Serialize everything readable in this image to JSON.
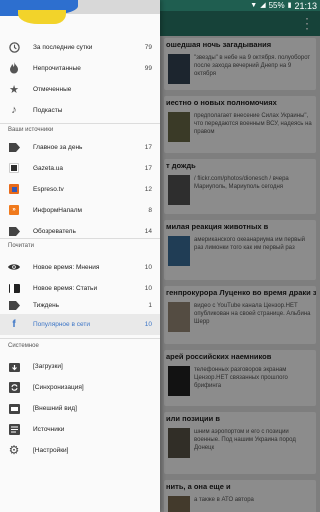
{
  "status": {
    "time": "21:13",
    "battery": "55%"
  },
  "colors": {
    "accent": "#3a74c6",
    "appbar": "#287868",
    "flag_blue": "#2d6fcf",
    "flag_yellow": "#f2d32a"
  },
  "feed": {
    "cards": [
      {
        "title": "ошедшая ночь загадывания",
        "text": "\"звезды\" в небе на 9 октября. полуоборот после захода вечерний Днепр на 9 октября"
      },
      {
        "title": "иестно о новых полномочиях",
        "text": "предполагает внесение Силах Украины\", что передаются военным ВСУ, надеясь на правом"
      },
      {
        "title": "т дождь",
        "text": "/ flickr.com/photos/dionesch / вчера Мариуполь, Мариуполь сегодня"
      },
      {
        "title": "милая реакция животных в",
        "text": "американского океанариума им первый раз лимонки того как им первый раз"
      },
      {
        "title": "генпрокурора Луценко во время драки за",
        "text": "видео с YouTube канала Цензор.НЕТ опубликован на своей странице. Альбина Шерр"
      },
      {
        "title": "арей российских наемников",
        "text": "телефонных разговоров экранам Цензор.НЕТ связанных прошлого брифинга"
      },
      {
        "title": "или позиции в",
        "text": "шним аэропортом и его с позиции военные. Под нашим Украина пород Донецк"
      },
      {
        "title": "нить, а она еще и",
        "text": "а также в АТО автора"
      }
    ]
  },
  "drawer": {
    "items": [
      {
        "label": "За последние сутки",
        "count": "79",
        "icon": "clock-icon"
      },
      {
        "label": "Непрочитанные",
        "count": "99",
        "icon": "fire-icon"
      },
      {
        "label": "Отмеченные",
        "count": "",
        "icon": "star-icon"
      },
      {
        "label": "Подкасты",
        "count": "",
        "icon": "music-note-icon"
      }
    ],
    "sources_header": "Ваши источники",
    "sources": [
      {
        "label": "Главное за день",
        "count": "17",
        "icon": "label-icon"
      },
      {
        "label": "Gazeta.ua",
        "count": "17",
        "icon": "gazeta-icon"
      },
      {
        "label": "Espreso.tv",
        "count": "12",
        "icon": "espreso-icon"
      },
      {
        "label": "ИнформНапалм",
        "count": "8",
        "icon": "informnapalm-icon"
      },
      {
        "label": "Обозреватель",
        "count": "14",
        "icon": "label-icon"
      }
    ],
    "read_header": "Почитати",
    "read": [
      {
        "label": "Новое время: Мнения",
        "count": "10",
        "icon": "eye-icon"
      },
      {
        "label": "Новое время: Статьи",
        "count": "10",
        "icon": "nv-icon"
      },
      {
        "label": "Тиждень",
        "count": "1",
        "icon": "label-icon"
      },
      {
        "label": "Популярное в сети",
        "count": "10",
        "icon": "facebook-icon"
      }
    ],
    "system_header": "Системное",
    "system": [
      {
        "label": "[Загрузки]",
        "icon": "download-icon"
      },
      {
        "label": "[Синхронизация]",
        "icon": "sync-icon"
      },
      {
        "label": "[Внешний вид]",
        "icon": "appearance-icon"
      },
      {
        "label": "Источники",
        "icon": "sources-icon"
      },
      {
        "label": "[Настройки]",
        "icon": "gear-icon"
      }
    ]
  }
}
